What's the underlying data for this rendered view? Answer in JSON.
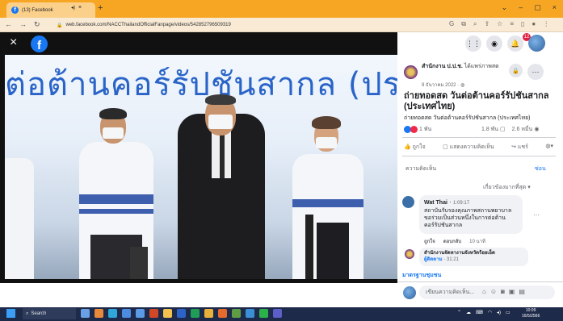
{
  "browser": {
    "tab_title": "(13) Facebook",
    "tab_close": "×",
    "new_tab": "+",
    "url": "web.facebook.com/NACCThailandOfficialFanpage/videos/542852796509319",
    "window_controls": [
      "⌄",
      "–",
      "▢",
      "×"
    ]
  },
  "video": {
    "banner_text": "ต่อต้านคอร์รัปชันสากล (ประ",
    "close_label": "×",
    "logo_letter": "f"
  },
  "header": {
    "notification_count": "12"
  },
  "post": {
    "page_name": "สำนักงาน ป.ป.ช.",
    "page_suffix": " ได้แพร่ภาพสด",
    "date": "9 ธันวาคม 2022 · ",
    "title": "ถ่ายทอดสด วันต่อต้านคอร์รัปชันสากล (ประเทศไทย)",
    "subtitle": "ถ่ายทอดสด วันต่อต้านคอร์รัปชันสากล (ประเทศไทย)",
    "reactions": "1 พัน",
    "comments_count": "1.8 พัน",
    "views": "2.6 หมื่น",
    "actions": {
      "like": "ถูกใจ",
      "comment": "แสดงความคิดเห็น",
      "share": "แชร์"
    },
    "comments_label": "ความคิดเห็น",
    "hide_label": "ซ่อน",
    "sort_label": "เกี่ยวข้องมากที่สุด"
  },
  "comments": [
    {
      "name": "Wat Thai",
      "time": "1:09:17",
      "text": "สถาบันรับรองคุณภาพสถานพยาบาลขอร่วมเป็นส่วนหนึ่งในการต่อต้านคอร์รัปชันสากล",
      "like": "ถูกใจ",
      "reply": "ตอบกลับ",
      "ago": "10 นาที"
    },
    {
      "name": "สำนักงานจัดหางานจังหวัดร้อยเอ็ด",
      "role": "ผู้ติดตาม",
      "time": "31:21"
    }
  ],
  "more_comments": "มาตรฐานชุมชน",
  "compose_placeholder": "เขียนความคิดเห็น...",
  "taskbar": {
    "search": "Search",
    "time": "10:09",
    "date": "16/5/2566"
  },
  "colors": {
    "accent": "#1877f2",
    "tab_bar": "#f6a623",
    "banner_blue": "#2a64c8"
  }
}
